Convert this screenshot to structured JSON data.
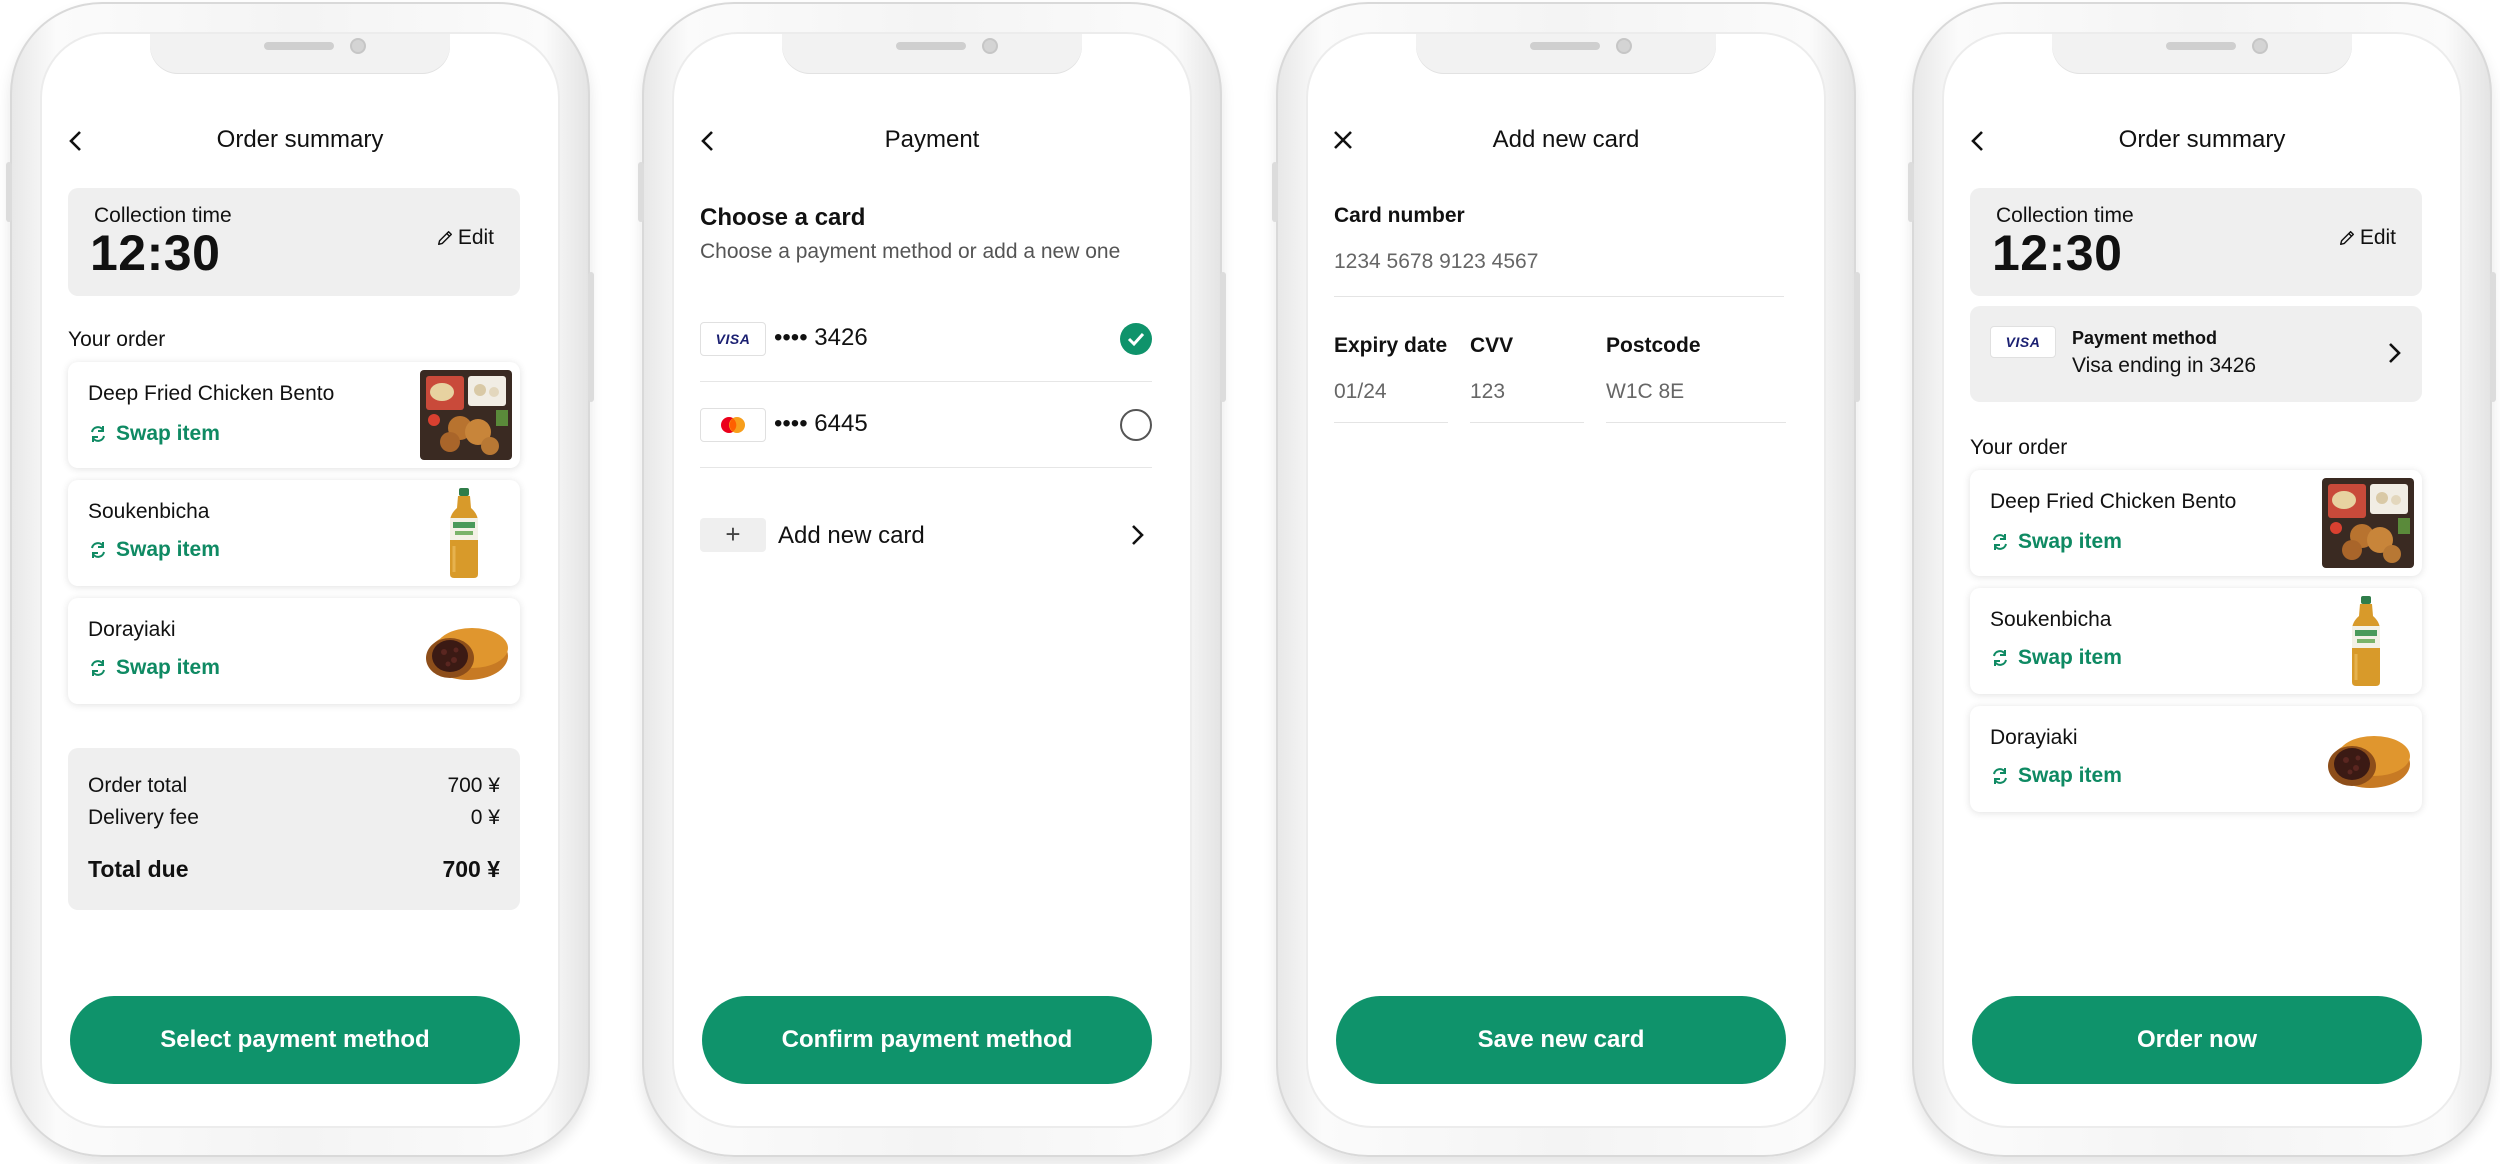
{
  "screens": [
    {
      "header": {
        "title": "Order summary",
        "nav_icon": "back-arrow-icon"
      },
      "collection": {
        "label": "Collection time",
        "time": "12:30",
        "edit_label": "Edit"
      },
      "your_order_label": "Your order",
      "items": [
        {
          "name": "Deep Fried Chicken Bento",
          "swap_label": "Swap item",
          "image": "bento-image"
        },
        {
          "name": "Soukenbicha",
          "swap_label": "Swap item",
          "image": "tea-bottle-image"
        },
        {
          "name": "Dorayiaki",
          "swap_label": "Swap item",
          "image": "dorayaki-image"
        }
      ],
      "totals": {
        "order_total_label": "Order total",
        "order_total_value": "700 ¥",
        "delivery_fee_label": "Delivery fee",
        "delivery_fee_value": "0 ¥",
        "total_due_label": "Total due",
        "total_due_value": "700 ¥"
      },
      "primary_button": "Select payment method"
    },
    {
      "header": {
        "title": "Payment",
        "nav_icon": "back-arrow-icon"
      },
      "heading": "Choose a card",
      "subheading": "Choose a payment method or add a new one",
      "cards": [
        {
          "brand": "VISA",
          "number": "•••• 3426",
          "selected": true
        },
        {
          "brand": "mastercard",
          "number": "•••• 6445",
          "selected": false
        }
      ],
      "add_card_label": "Add new card",
      "add_card_icon": "+",
      "primary_button": "Confirm payment method"
    },
    {
      "header": {
        "title": "Add new card",
        "nav_icon": "close-icon"
      },
      "card_number": {
        "label": "Card number",
        "value": "1234 5678 9123 4567"
      },
      "expiry": {
        "label": "Expiry date",
        "value": "01/24"
      },
      "cvv": {
        "label": "CVV",
        "value": "123"
      },
      "postcode": {
        "label": "Postcode",
        "value": "W1C 8E"
      },
      "primary_button": "Save new card"
    },
    {
      "header": {
        "title": "Order summary",
        "nav_icon": "back-arrow-icon"
      },
      "collection": {
        "label": "Collection time",
        "time": "12:30",
        "edit_label": "Edit"
      },
      "payment_method": {
        "brand": "VISA",
        "title": "Payment method",
        "detail": "Visa ending in 3426"
      },
      "your_order_label": "Your order",
      "items": [
        {
          "name": "Deep Fried Chicken Bento",
          "swap_label": "Swap item",
          "image": "bento-image"
        },
        {
          "name": "Soukenbicha",
          "swap_label": "Swap item",
          "image": "tea-bottle-image"
        },
        {
          "name": "Dorayiaki",
          "swap_label": "Swap item",
          "image": "dorayaki-image"
        }
      ],
      "primary_button": "Order now"
    }
  ],
  "colors": {
    "accent": "#0f936b",
    "swap_text": "#0f8a63",
    "panel": "#efefef"
  }
}
